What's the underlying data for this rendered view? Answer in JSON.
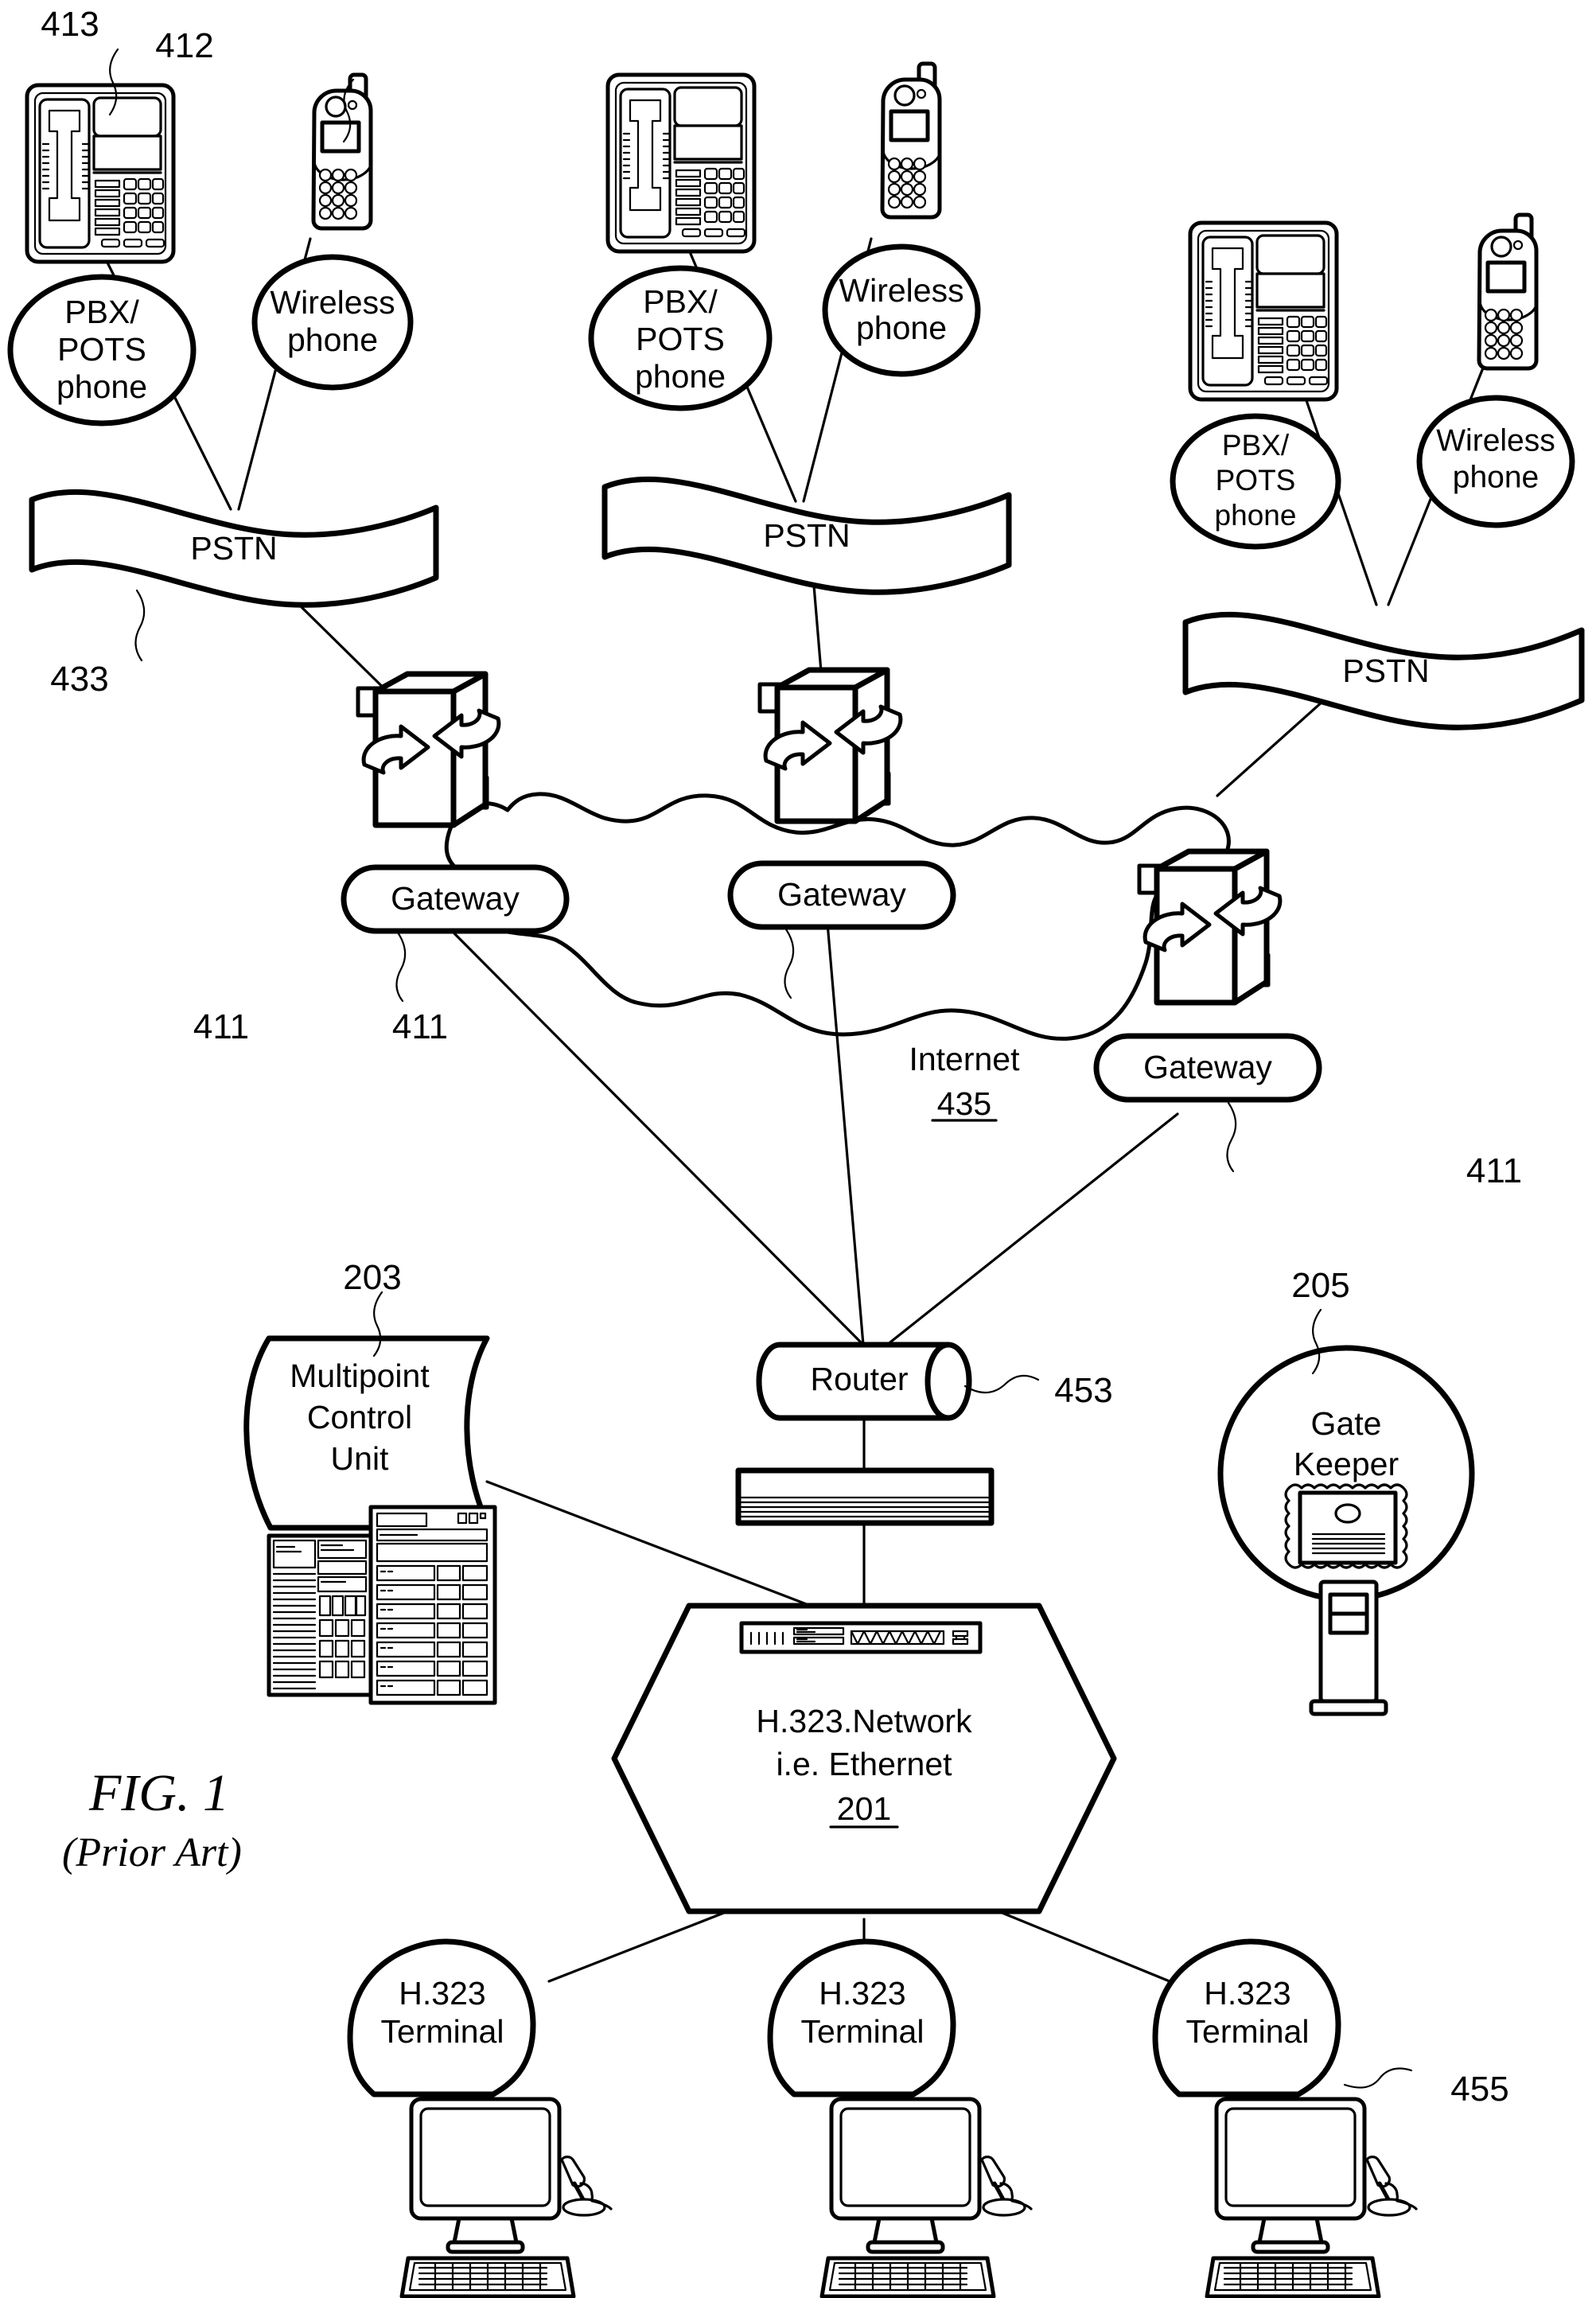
{
  "figure": {
    "title": "FIG. 1",
    "subtitle": "(Prior Art)"
  },
  "nodes": {
    "pbx_pots_phone": "PBX/\nPOTS\nphone",
    "pbx_pots_line1": "PBX/",
    "pbx_pots_line2": "POTS",
    "pbx_pots_line3": "phone",
    "wireless_line1": "Wireless",
    "wireless_line2": "phone",
    "pstn": "PSTN",
    "gateway": "Gateway",
    "internet_label": "Internet",
    "internet_ref": "435",
    "router": "Router",
    "mcu_line1": "Multipoint",
    "mcu_line2": "Control",
    "mcu_line3": "Unit",
    "gatekeeper_line1": "Gate",
    "gatekeeper_line2": "Keeper",
    "h323_network_line1": "H.323.Network",
    "h323_network_line2": "i.e. Ethernet",
    "h323_network_ref": "201",
    "h323_terminal_line1": "H.323",
    "h323_terminal_line2": "Terminal"
  },
  "reference_numerals": {
    "pbx_pots_phone_icon": "413",
    "wireless_phone_icon": "412",
    "pstn_left": "433",
    "gateway_left": "411",
    "gateway_middle": "411",
    "gateway_right": "411",
    "internet": "435",
    "mcu": "203",
    "gatekeeper": "205",
    "router": "453",
    "h323_network": "201",
    "h323_terminal": "455"
  },
  "groups": [
    {
      "name": "left-access-group",
      "pbx_label": [
        "PBX/",
        "POTS",
        "phone"
      ],
      "wireless_label": [
        "Wireless",
        "phone"
      ],
      "pstn_label": "PSTN",
      "gateway_label": "Gateway"
    },
    {
      "name": "middle-access-group",
      "pbx_label": [
        "PBX/",
        "POTS",
        "phone"
      ],
      "wireless_label": [
        "Wireless",
        "phone"
      ],
      "pstn_label": "PSTN",
      "gateway_label": "Gateway"
    },
    {
      "name": "right-access-group",
      "pbx_label": [
        "PBX/",
        "POTS",
        "phone"
      ],
      "wireless_label": [
        "Wireless",
        "phone"
      ],
      "pstn_label": "PSTN",
      "gateway_label": "Gateway"
    }
  ],
  "terminals": [
    {
      "line1": "H.323",
      "line2": "Terminal"
    },
    {
      "line1": "H.323",
      "line2": "Terminal"
    },
    {
      "line1": "H.323",
      "line2": "Terminal"
    }
  ],
  "colors": {
    "ink": "#000000",
    "paper": "#ffffff"
  }
}
